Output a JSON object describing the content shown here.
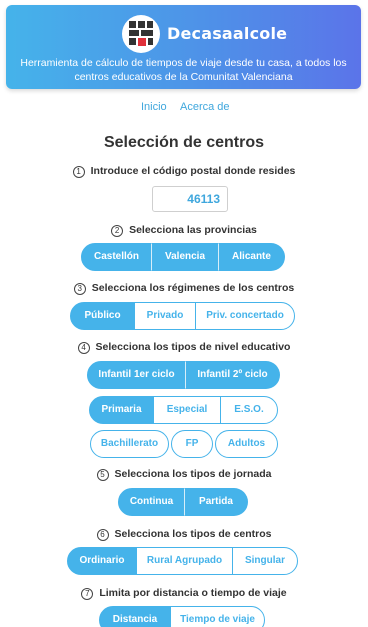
{
  "header": {
    "title": "Decasaalcole",
    "subtitle": "Herramienta de cálculo de tiempos de viaje desde tu casa, a todos los centros educativos de la Comunitat Valenciana"
  },
  "nav": {
    "home": "Inicio",
    "about": "Acerca de"
  },
  "section_title": "Selección de centros",
  "steps": {
    "s1": {
      "num": "1",
      "label": "Introduce el código postal donde resides"
    },
    "s2": {
      "num": "2",
      "label": "Selecciona las provincias"
    },
    "s3": {
      "num": "3",
      "label": "Selecciona los régimenes de los centros"
    },
    "s4": {
      "num": "4",
      "label": "Selecciona los tipos de nivel educativo"
    },
    "s5": {
      "num": "5",
      "label": "Selecciona los tipos de jornada"
    },
    "s6": {
      "num": "6",
      "label": "Selecciona los tipos de centros"
    },
    "s7": {
      "num": "7",
      "label": "Limita por distancia o tiempo de viaje"
    }
  },
  "postal_code": {
    "value": "46113"
  },
  "provinces": [
    "Castellón",
    "Valencia",
    "Alicante"
  ],
  "regimes": [
    "Público",
    "Privado",
    "Priv. concertado"
  ],
  "levels": {
    "row1": [
      "Infantil 1er ciclo",
      "Infantil 2º ciclo"
    ],
    "row2": [
      "Primaria",
      "Especial",
      "E.S.O."
    ],
    "row3": [
      "Bachillerato",
      "FP",
      "Adultos"
    ]
  },
  "schedules": [
    "Continua",
    "Partida"
  ],
  "center_types": [
    "Ordinario",
    "Rural Agrupado",
    "Singular"
  ],
  "limit": [
    "Distancia",
    "Tiempo de viaje"
  ],
  "colors": {
    "accent": "#45b3ea",
    "header_start": "#45b3ea",
    "header_end": "#5b74e9"
  }
}
